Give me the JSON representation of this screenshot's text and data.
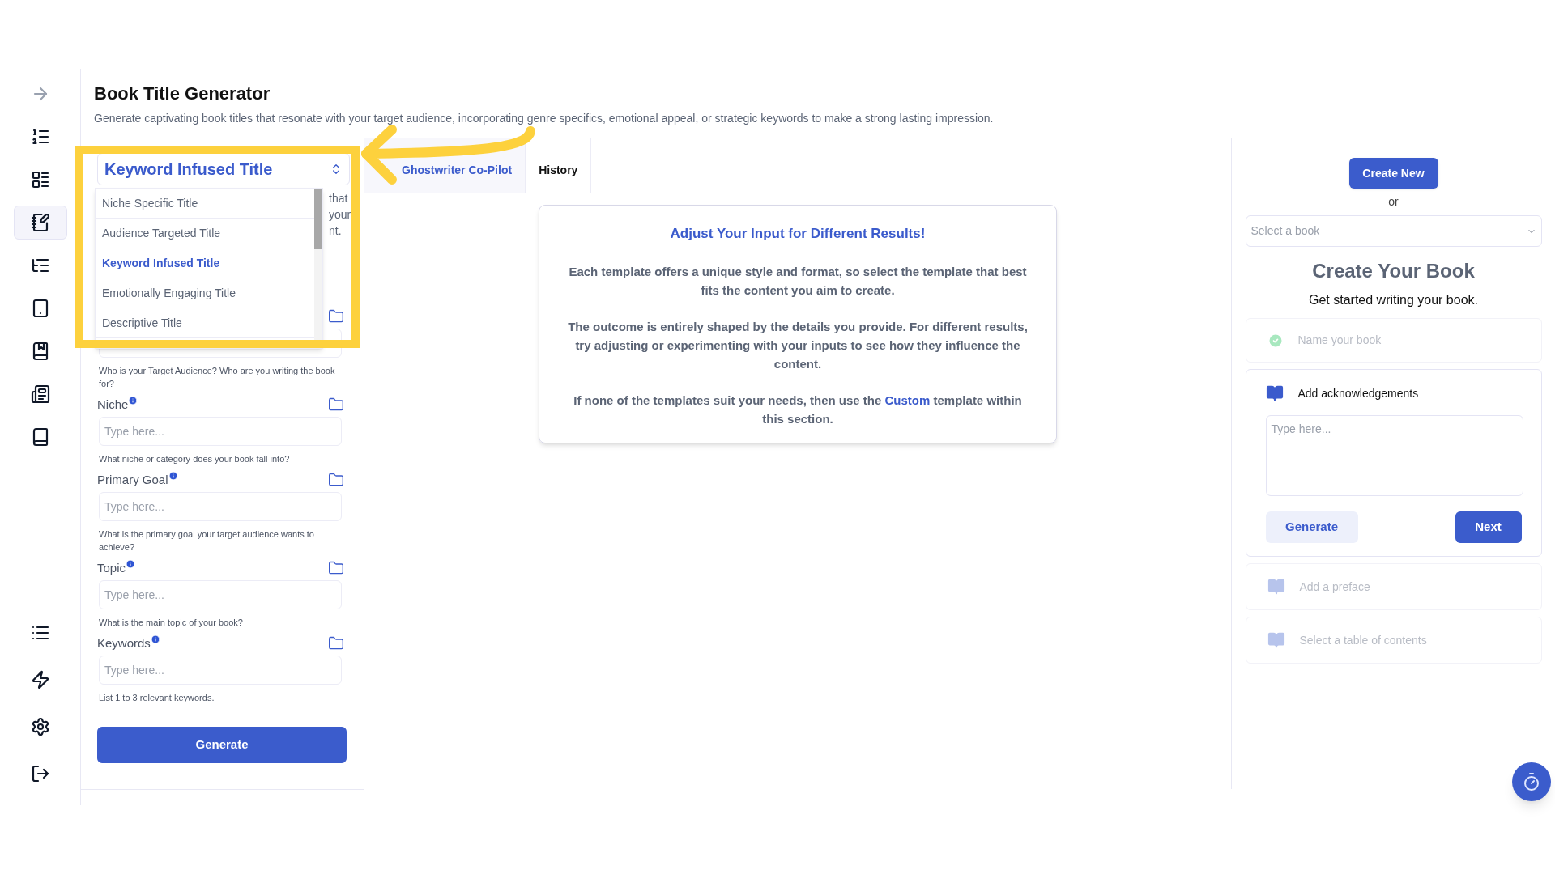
{
  "sidebar": {
    "items": [
      {
        "selected": false
      },
      {
        "selected": false
      },
      {
        "selected": false
      },
      {
        "selected": true
      },
      {
        "selected": false
      },
      {
        "selected": false
      },
      {
        "selected": false
      },
      {
        "selected": false
      },
      {
        "selected": false
      }
    ],
    "bottom_items": [
      {
        "selected": false
      },
      {
        "selected": false
      },
      {
        "selected": false
      },
      {
        "selected": false
      }
    ]
  },
  "header": {
    "title": "Book Title Generator",
    "description": "Generate captivating book titles that resonate with your target audience, incorporating genre specifics, emotional appeal, or strategic keywords to make a strong lasting impression."
  },
  "template_select": {
    "value": "Keyword Infused Title",
    "options": [
      {
        "label": "Niche Specific Title",
        "selected": false
      },
      {
        "label": "Audience Targeted Title",
        "selected": false
      },
      {
        "label": "Keyword Infused Title",
        "selected": true
      },
      {
        "label": "Emotionally Engaging Title",
        "selected": false
      },
      {
        "label": "Descriptive Title",
        "selected": false
      }
    ]
  },
  "template_description_fragments": [
    "that",
    "your",
    "nt."
  ],
  "fields": [
    {
      "hint": "Who is your Target Audience? Who are you writing the book for?"
    },
    {
      "label": "Niche",
      "placeholder": "Type here...",
      "hint": "What niche or category does your book fall into?"
    },
    {
      "label": "Primary Goal",
      "placeholder": "Type here...",
      "hint": "What is the primary goal your target audience wants to achieve?"
    },
    {
      "label": "Topic",
      "placeholder": "Type here...",
      "hint": "What is the main topic of your book?"
    },
    {
      "label": "Keywords",
      "placeholder": "Type here...",
      "hint": "List 1 to 3 relevant keywords."
    }
  ],
  "generate_button": "Generate",
  "tabs": [
    {
      "label": "Ghostwriter Co-Pilot",
      "selected": true
    },
    {
      "label": "History",
      "selected": false
    }
  ],
  "info_card": {
    "title": "Adjust Your Input for Different Results!",
    "paragraphs": [
      "Each template offers a unique style and format, so select the template that best fits the content you aim to create.",
      "The outcome is entirely shaped by the details you provide. For different results, try adjusting or experimenting with your inputs to see how they influence the content."
    ],
    "last_paragraph": {
      "before": "If none of the templates suit your needs, then use the",
      "link": "Custom",
      "after": "template within this section."
    }
  },
  "book_panel": {
    "create_button": "Create New",
    "or": "or",
    "book_select": {
      "placeholder": "Select a book"
    },
    "title": "Create Your Book",
    "subtitle": "Get started writing your book.",
    "steps": [
      {
        "kind": "done",
        "label": "Name your book"
      },
      {
        "kind": "active",
        "label": "Add acknowledgements",
        "placeholder": "Type here...",
        "secondary_button": "Generate",
        "primary_button": "Next"
      },
      {
        "kind": "pending",
        "label": "Add a preface"
      },
      {
        "kind": "pending",
        "label": "Select a table of contents"
      }
    ]
  }
}
